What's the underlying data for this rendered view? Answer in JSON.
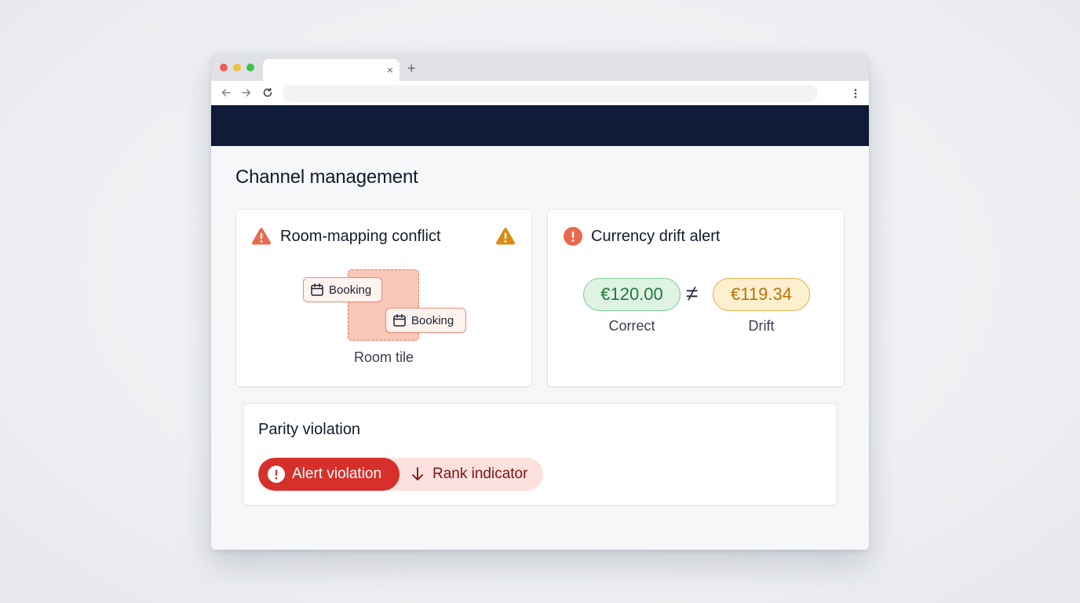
{
  "browser": {
    "tab_close_glyph": "×",
    "new_tab_glyph": "+"
  },
  "page": {
    "title": "Channel management"
  },
  "room_mapping_card": {
    "title": "Room-mapping conflict",
    "booking_chips": [
      "Booking",
      "Booking"
    ],
    "room_tile_label": "Room tile",
    "icons": [
      "warning-triangle-icon",
      "warning-triangle-icon"
    ]
  },
  "currency_card": {
    "title": "Currency drift alert",
    "correct_value": "€120.00",
    "correct_label": "Correct",
    "not_equal_glyph": "≠",
    "drift_value": "€119.34",
    "drift_label": "Drift",
    "icons": [
      "alert-circle-icon"
    ]
  },
  "parity_card": {
    "title": "Parity violation",
    "alert_label": "Alert violation",
    "rank_label": "Rank indicator",
    "icons": [
      "alert-circle-icon",
      "arrow-down-icon"
    ]
  },
  "colors": {
    "app_bar": "#0f1b38",
    "warning_red": "#e86a4e",
    "warning_amber": "#d98b12",
    "correct_green": "#1d7a3f",
    "drift_amber": "#b8730c",
    "violation_red": "#d6302b"
  }
}
